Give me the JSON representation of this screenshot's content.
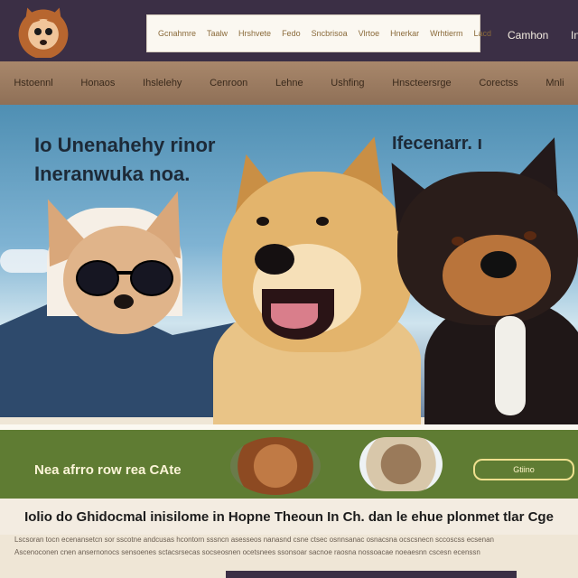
{
  "header": {
    "search_links": [
      "Gcnahmre",
      "Taalw",
      "Hrshvete",
      "Fedo",
      "Sncbrisoa",
      "Vlrtoe",
      "Hnerkar",
      "Wrhtierm",
      "Lacd"
    ],
    "right_link": "Camhon",
    "far_right": "In"
  },
  "nav": {
    "items": [
      "Hstoennl",
      "Honaos",
      "Ihslelehy",
      "Cenroon",
      "Lehne",
      "Ushfing",
      "Hnscteersrge",
      "Corectss",
      "Mnli"
    ]
  },
  "hero": {
    "headline_left_1": "Io Unenahehy rinor",
    "headline_left_2": "Ineranwuka noa.",
    "headline_right": "Ifecenarr. ı"
  },
  "promo": {
    "text": "Nea afrro row rea CAte",
    "button_label": "Gtiino"
  },
  "tagline": "Iolio do Ghidocmal inisilome in Hopne Theoun In Ch. dan le ehue plonmet tlar Cge",
  "fine_print": [
    "Lscsoran tocn ecenansetcn sor sscotne andcusas hcontorn sssncn asesseos nanasnd csne ctsec osnnsanac osnacsna ocscsnecn sccoscss ecsenan",
    "Ascenoconen cnen ansernonocs sensoenes sctacsrsecas socseosnen ocetsnees ssonsoar sacnoe raosna nossoacae noeaesnn cscesn ecenssn"
  ]
}
